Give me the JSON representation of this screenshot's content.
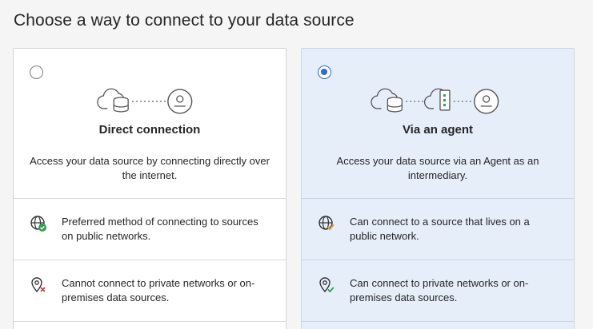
{
  "page": {
    "heading": "Choose a way to connect to your data source"
  },
  "options": [
    {
      "title": "Direct connection",
      "description": "Access your data source by connecting directly over the internet.",
      "selected": false,
      "features": [
        {
          "icon": "globe-check-icon",
          "text": "Preferred method of connecting to sources on public networks."
        },
        {
          "icon": "location-blocked-icon",
          "text": "Cannot connect to private networks or on-premises data sources."
        }
      ]
    },
    {
      "title": "Via an agent",
      "description": "Access your data source via an Agent as an intermediary.",
      "selected": true,
      "features": [
        {
          "icon": "globe-check-icon",
          "text": "Can connect to a source that lives on a public network."
        },
        {
          "icon": "location-check-icon",
          "text": "Can connect to private networks or on-premises data sources."
        }
      ]
    }
  ],
  "colors": {
    "accent": "#2b6cd4",
    "selected_card_bg": "#e6eefa",
    "success": "#2e9e4f",
    "warning": "#e0a33a",
    "error": "#d63b3b"
  }
}
